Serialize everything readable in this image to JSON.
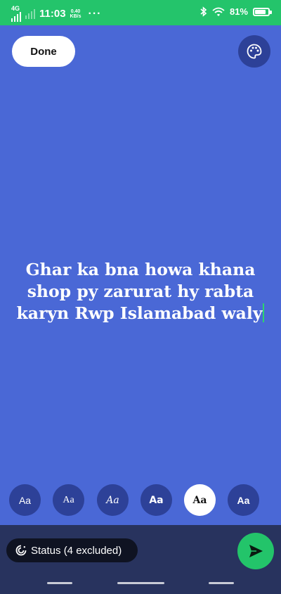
{
  "status_bar": {
    "network": "4G",
    "time": "11:03",
    "speed_value": "0.40",
    "speed_unit": "KB/s",
    "more": "···",
    "battery_text": "81%",
    "battery_level": 0.81
  },
  "toolbar": {
    "done_label": "Done",
    "palette_icon": "palette-icon"
  },
  "message": {
    "text": "Ghar ka bna howa khana shop py zarurat hy rabta karyn Rwp Islamabad waly"
  },
  "font_options": [
    {
      "label": "Aa"
    },
    {
      "label": "Aa"
    },
    {
      "label": "Aa"
    },
    {
      "label": "Aa"
    },
    {
      "label": "Aa",
      "selected": true
    },
    {
      "label": "Aa"
    }
  ],
  "bottom": {
    "status_label": "Status (4 excluded)",
    "status_icon": "status-ring-icon",
    "send_icon": "send-icon"
  },
  "colors": {
    "background": "#4a68d6",
    "status_bar": "#24c46b",
    "accent": "#23c46a",
    "bottom_bar": "#28335e"
  }
}
